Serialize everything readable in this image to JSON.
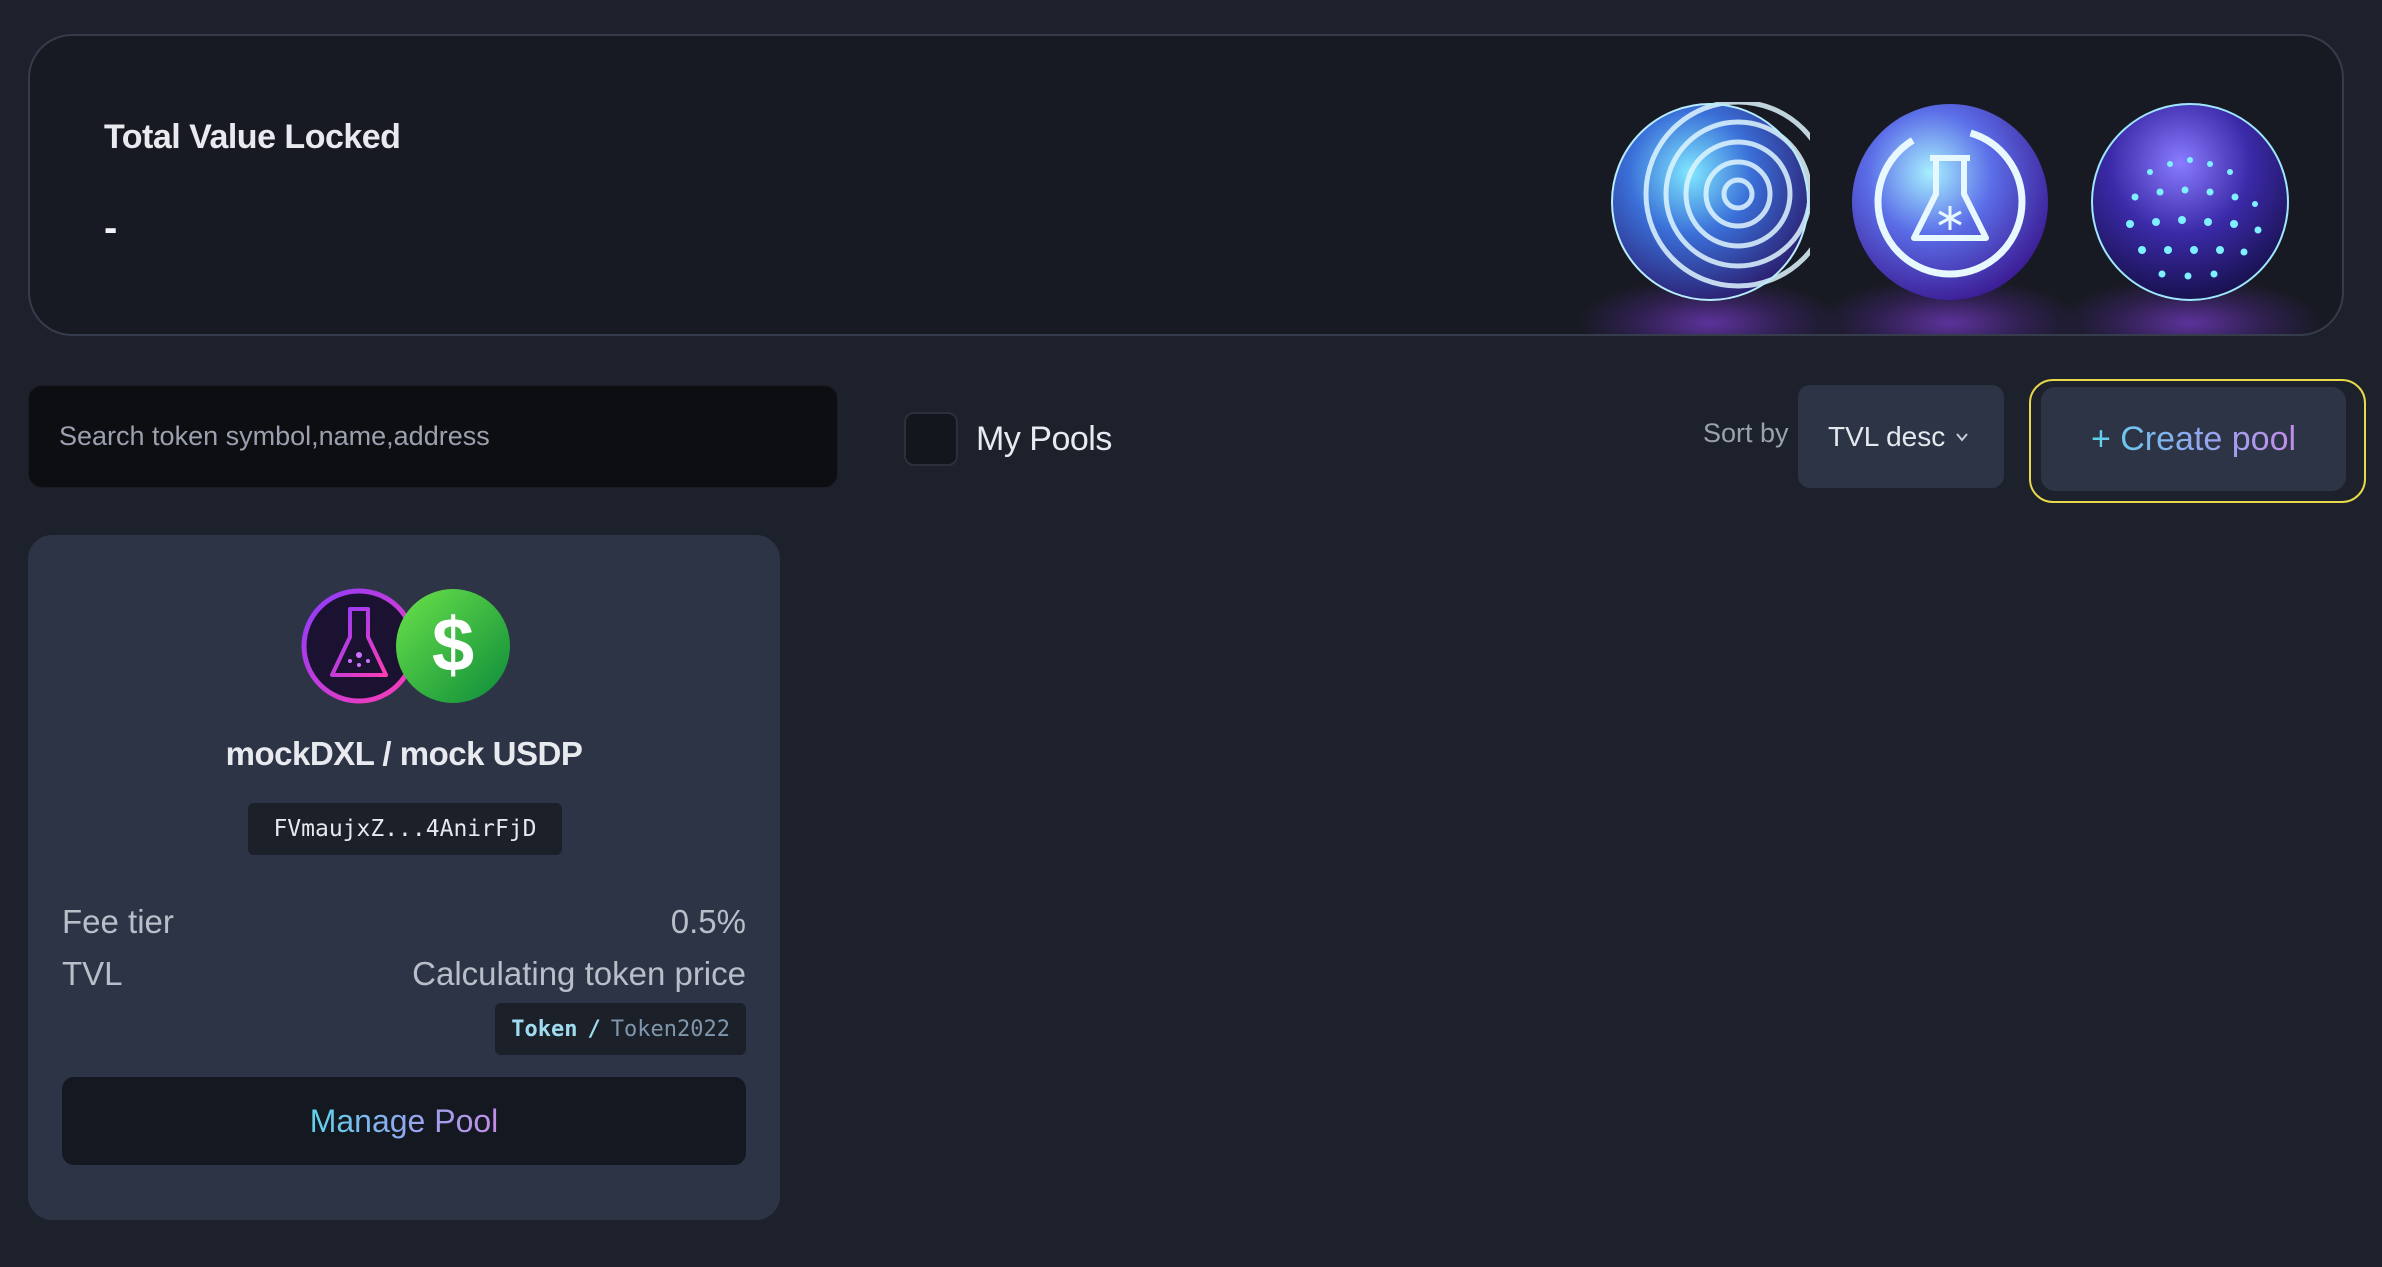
{
  "banner": {
    "title": "Total Value Locked",
    "value": "-",
    "decor_icons": [
      "concentric-ripple-orb-icon",
      "flask-orb-icon",
      "dotted-sphere-orb-icon"
    ]
  },
  "toolbar": {
    "search_placeholder": "Search token symbol,name,address",
    "my_pools_label": "My Pools",
    "my_pools_checked": false,
    "sort_label": "Sort by",
    "sort_value": "TVL desc",
    "create_pool_label": "+ Create pool"
  },
  "pools": [
    {
      "pair_name": "mockDXL / mock USDP",
      "address": "FVmaujxZ...4AnirFjD",
      "token_icons": [
        "flask-token-icon",
        "dollar-token-icon"
      ],
      "fee_tier_label": "Fee tier",
      "fee_tier_value": "0.5%",
      "tvl_label": "TVL",
      "tvl_value": "Calculating token price",
      "program_a": "Token",
      "program_sep": "/",
      "program_b": "Token2022",
      "manage_label": "Manage Pool"
    }
  ],
  "colors": {
    "background": "#1d212c",
    "card": "#2c3445",
    "accent_cyan": "#5fd4ec",
    "accent_purple": "#c48ce8",
    "highlight_outline": "#e8d84a"
  }
}
